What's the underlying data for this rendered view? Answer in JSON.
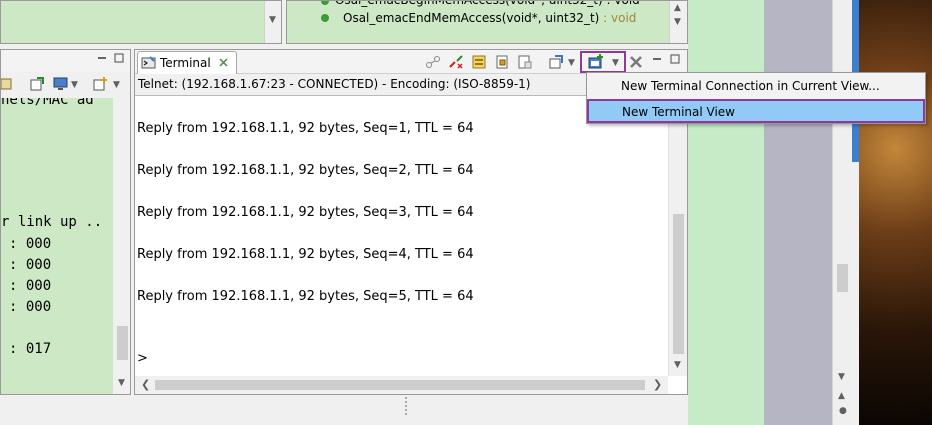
{
  "outline": {
    "row1_text": "Osal_emacBeginMemAccess(void*, uint32_t) : void",
    "row2_name": "Osal_emacEndMemAccess(void*, uint32_t)",
    "row2_type": " : void"
  },
  "left_console": {
    "path_fragment": "nels/MAC ad",
    "lines": [
      "r link up ..",
      ": 000",
      ": 000",
      ": 000",
      ": 000",
      ": 017"
    ]
  },
  "terminal": {
    "tab_label": "Terminal",
    "status": "Telnet: (192.168.1.67:23 - CONNECTED) - Encoding: (ISO-8859-1)",
    "lines": [
      "Reply from 192.168.1.1, 92 bytes, Seq=1, TTL = 64",
      "Reply from 192.168.1.1, 92 bytes, Seq=2, TTL = 64",
      "Reply from 192.168.1.1, 92 bytes, Seq=3, TTL = 64",
      "Reply from 192.168.1.1, 92 bytes, Seq=4, TTL = 64",
      "Reply from 192.168.1.1, 92 bytes, Seq=5, TTL = 64"
    ],
    "prompt": ">"
  },
  "menu": {
    "items": [
      "New Terminal Connection in Current View...",
      "New Terminal View"
    ],
    "selected": "New Terminal View"
  },
  "colors": {
    "console_bg": "#cde8c4",
    "highlight_border": "#8e3a9d",
    "selection": "#91c9f7"
  }
}
